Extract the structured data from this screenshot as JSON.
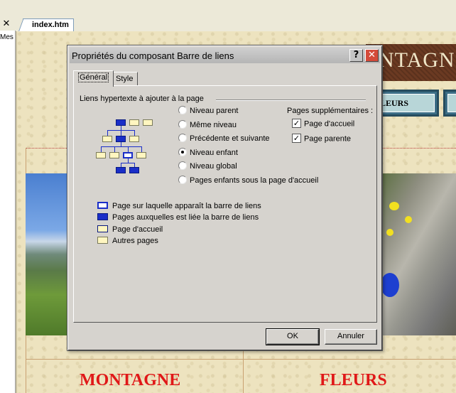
{
  "editor": {
    "close_glyph": "✕",
    "left_pane_text": "Mes",
    "document_tab": "index.htm"
  },
  "page_preview": {
    "banner_text": "NTAGN",
    "nav_button_1": "LEURS",
    "captions": [
      "MONTAGNE",
      "FLEURS"
    ]
  },
  "dialog": {
    "title": "Propriétés du composant Barre de liens",
    "help_glyph": "?",
    "close_glyph": "✕",
    "tabs": [
      {
        "label": "Général",
        "active": true
      },
      {
        "label": "Style",
        "active": false
      }
    ],
    "group_label": "Liens hypertexte à ajouter à la page",
    "radio_options": [
      {
        "label": "Niveau parent",
        "checked": false
      },
      {
        "label": "Même niveau",
        "checked": false
      },
      {
        "label": "Précédente et suivante",
        "checked": false
      },
      {
        "label": "Niveau enfant",
        "checked": true
      },
      {
        "label": "Niveau global",
        "checked": false
      },
      {
        "label": "Pages enfants sous la page d'accueil",
        "checked": false
      }
    ],
    "supplementary": {
      "label": "Pages supplémentaires :",
      "options": [
        {
          "label": "Page d'accueil",
          "checked": true
        },
        {
          "label": "Page parente",
          "checked": true
        }
      ]
    },
    "legend": [
      {
        "label": "Page sur laquelle apparaît la barre de liens",
        "icon": "current-page-icon"
      },
      {
        "label": "Pages auxquelles est liée la barre de liens",
        "icon": "linked-page-icon"
      },
      {
        "label": "Page d'accueil",
        "icon": "home-page-icon"
      },
      {
        "label": "Autres pages",
        "icon": "other-page-icon"
      }
    ],
    "ok_label": "OK",
    "cancel_label": "Annuler"
  },
  "colors": {
    "link_blue": "#1a2ec8",
    "other_page_yellow": "#fff6c0",
    "caption_red": "#e01818"
  }
}
